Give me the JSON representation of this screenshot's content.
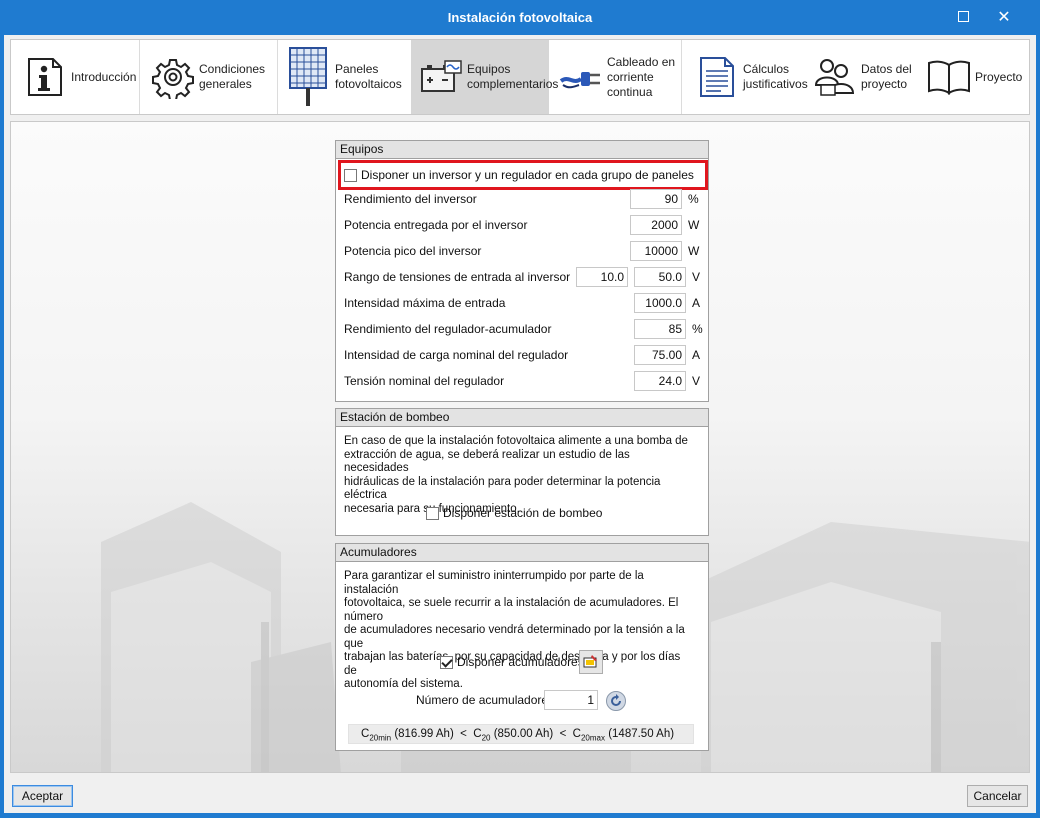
{
  "window": {
    "title": "Instalación fotovoltaica",
    "maximize_icon": "maximize-icon",
    "close_icon": "close-icon",
    "close_glyph": "✕"
  },
  "tabs": [
    {
      "label": "Introducción",
      "icon": "info-icon"
    },
    {
      "label_lines": [
        "Condiciones",
        "generales"
      ],
      "icon": "gear-icon"
    },
    {
      "label_lines": [
        "Paneles",
        "fotovoltaicos"
      ],
      "icon": "solar-panel-icon"
    },
    {
      "label_lines": [
        "Equipos",
        "complementarios"
      ],
      "icon": "battery-regulator-icon",
      "active": true
    },
    {
      "label_lines": [
        "Cableado en",
        "corriente",
        "continua"
      ],
      "icon": "cable-icon"
    },
    {
      "label_lines": [
        "Cálculos",
        "justificativos"
      ],
      "icon": "document-icon"
    },
    {
      "label_lines": [
        "Datos del",
        "proyecto"
      ],
      "icon": "users-icon"
    },
    {
      "label": "Proyecto",
      "icon": "open-book-icon"
    }
  ],
  "equipos": {
    "header": "Equipos",
    "checkbox_label": "Disponer un inversor y un regulador en cada grupo de paneles",
    "checkbox_checked": false,
    "fields": {
      "rendimiento_inversor": {
        "label": "Rendimiento del inversor",
        "value": "90",
        "unit": "%"
      },
      "potencia_entregada": {
        "label": "Potencia entregada por el inversor",
        "value": "2000",
        "unit": "W"
      },
      "potencia_pico": {
        "label": "Potencia pico del inversor",
        "value": "10000",
        "unit": "W"
      },
      "rango_tensiones": {
        "label": "Rango de tensiones de entrada al inversor",
        "value_min": "10.0",
        "value_max": "50.0",
        "unit": "V"
      },
      "intensidad_maxima": {
        "label": "Intensidad máxima de entrada",
        "value": "1000.0",
        "unit": "A"
      },
      "rendimiento_regulador": {
        "label": "Rendimiento del regulador-acumulador",
        "value": "85",
        "unit": "%"
      },
      "intensidad_carga": {
        "label": "Intensidad de carga nominal del regulador",
        "value": "75.00",
        "unit": "A"
      },
      "tension_nominal": {
        "label": "Tensión nominal del regulador",
        "value": "24.0",
        "unit": "V"
      }
    }
  },
  "bombeo": {
    "header": "Estación de bombeo",
    "description_lines": [
      "En caso de que la instalación fotovoltaica alimente a una bomba de",
      "extracción de agua, se deberá realizar un estudio de las necesidades",
      "hidráulicas de la instalación para poder determinar la potencia eléctrica",
      "necesaria para su funcionamiento."
    ],
    "checkbox_label": "Disponer estación de bombeo",
    "checkbox_checked": false
  },
  "acumuladores": {
    "header": "Acumuladores",
    "description_lines": [
      "Para garantizar el suministro ininterrumpido por parte de la instalación",
      "fotovoltaica, se suele recurrir a la instalación de acumuladores. El número",
      "de acumuladores necesario vendrá determinado por la tensión a la que",
      "trabajan las baterías, por su capacidad de descarga y por los días de",
      "autonomía del sistema."
    ],
    "checkbox_label": "Disponer acumuladores",
    "checkbox_checked": true,
    "edit_icon": "edit-icon",
    "numero_label": "Número de acumuladores",
    "numero_value": "1",
    "refresh_icon": "refresh-icon",
    "capacity": {
      "c_letter": "C",
      "min_sub": "20min",
      "min_value": "(816.99 Ah)",
      "lt": "<",
      "c20_sub": "20",
      "c20_value": "(850.00 Ah)",
      "max_sub": "20max",
      "max_value": "(1487.50 Ah)"
    }
  },
  "footer": {
    "accept_label": "Aceptar",
    "cancel_label": "Cancelar"
  },
  "colors": {
    "titlebar": "#1f7bd0",
    "highlight": "#e0161e",
    "active_tab": "#d6d6d6"
  }
}
